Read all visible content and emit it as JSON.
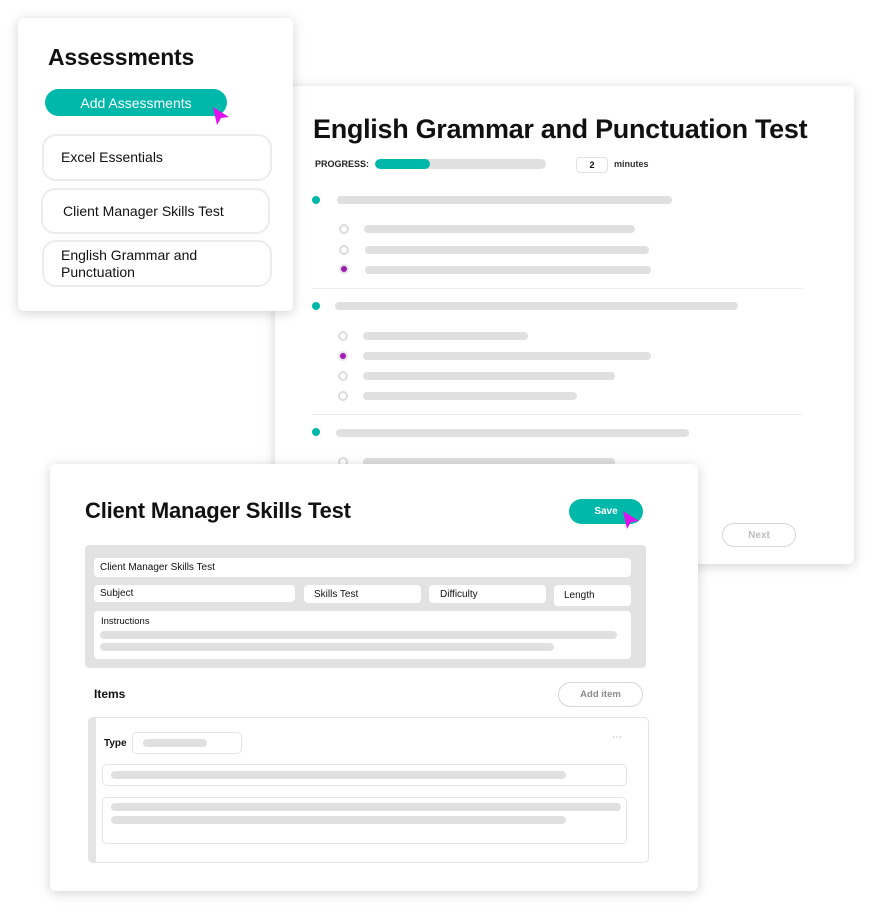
{
  "assessments_panel": {
    "title": "Assessments",
    "add_button_label": "Add Assessments",
    "items": [
      {
        "label": "Excel Essentials"
      },
      {
        "label": "Client Manager Skills Test"
      },
      {
        "label": "English Grammar and Punctuation"
      }
    ]
  },
  "test_panel": {
    "title": "English Grammar and Punctuation Test",
    "progress_label": "PROGRESS:",
    "progress_percent": 32,
    "minutes_value": "2",
    "minutes_label": "minutes",
    "next_button_label": "Next",
    "questions": [
      {
        "options": 3,
        "selected_index": 2
      },
      {
        "options": 4,
        "selected_index": 1
      },
      {
        "options": 1,
        "selected_index": null
      }
    ]
  },
  "editor_panel": {
    "title": "Client Manager Skills Test",
    "save_button_label": "Save",
    "fields": {
      "name_value": "Client Manager Skills Test",
      "subject_placeholder": "Subject",
      "type_value": "Skills Test",
      "difficulty_placeholder": "Difficulty",
      "length_placeholder": "Length",
      "instructions_label": "Instructions"
    },
    "items_label": "Items",
    "add_item_label": "Add item",
    "item_card": {
      "type_label": "Type",
      "menu_icon": "more-horizontal-icon"
    }
  },
  "colors": {
    "accent": "#00b8a9",
    "selection": "#a21bb6",
    "cursor": "#e010f0",
    "placeholder_bar": "#e0e0e0"
  }
}
